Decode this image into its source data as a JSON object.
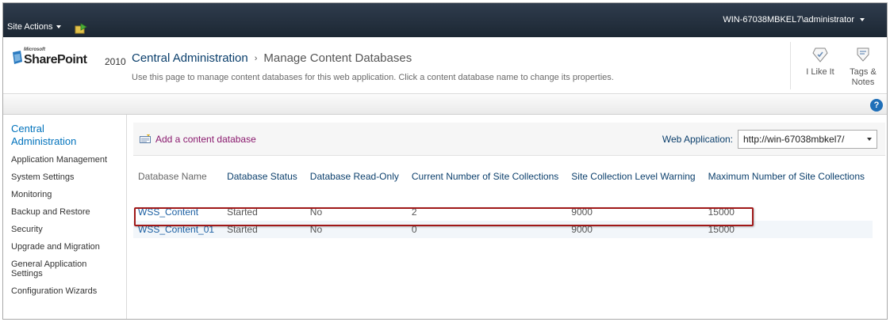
{
  "topbar": {
    "site_actions_label": "Site Actions",
    "user_label": "WIN-67038MBKEL7\\administrator"
  },
  "logo": {
    "microsoft": "Microsoft",
    "product": "SharePoint",
    "year": "2010"
  },
  "title": {
    "root": "Central Administration",
    "separator": "›",
    "current": "Manage Content Databases",
    "description": "Use this page to manage content databases for this web application. Click a content database name to change its properties."
  },
  "social": {
    "like_label": "I Like It",
    "tags_label_line1": "Tags &",
    "tags_label_line2": "Notes"
  },
  "help": {
    "symbol": "?"
  },
  "leftnav": {
    "header_line1": "Central",
    "header_line2": "Administration",
    "items": [
      {
        "label": "Application Management"
      },
      {
        "label": "System Settings"
      },
      {
        "label": "Monitoring"
      },
      {
        "label": "Backup and Restore"
      },
      {
        "label": "Security"
      },
      {
        "label": "Upgrade and Migration"
      },
      {
        "label": "General Application Settings"
      },
      {
        "label": "Configuration Wizards"
      }
    ]
  },
  "toolbar": {
    "add_label": "Add a content database",
    "webapp_label": "Web Application:",
    "webapp_value": "http://win-67038mbkel7/"
  },
  "table": {
    "columns": [
      "Database Name",
      "Database Status",
      "Database Read-Only",
      "Current Number of Site Collections",
      "Site Collection Level Warning",
      "Maximum Number of Site Collections"
    ],
    "rows": [
      {
        "name": "WSS_Content",
        "status": "Started",
        "readonly": "No",
        "current": "2",
        "warning": "9000",
        "max": "15000"
      },
      {
        "name": "WSS_Content_01",
        "status": "Started",
        "readonly": "No",
        "current": "0",
        "warning": "9000",
        "max": "15000"
      }
    ]
  },
  "colors": {
    "topbar": "#1c2733",
    "link": "#1b5fa2",
    "add_link": "#8a1a6e",
    "highlight_border": "#a01818"
  }
}
